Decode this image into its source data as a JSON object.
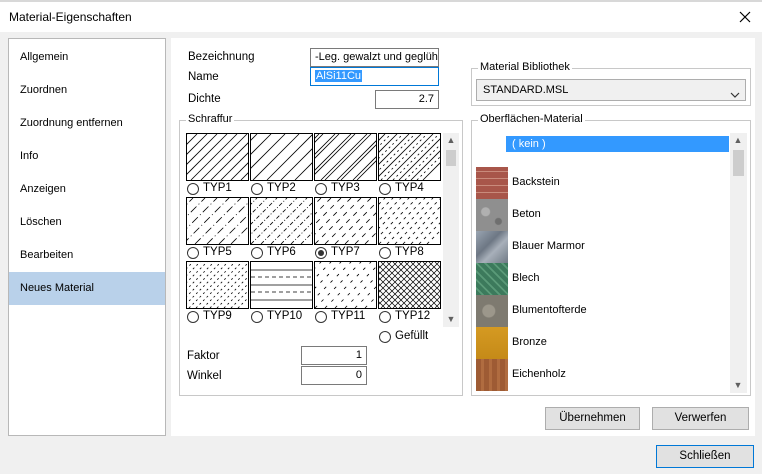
{
  "window": {
    "title": "Material-Eigenschaften"
  },
  "sidebar": {
    "items": [
      {
        "label": "Allgemein"
      },
      {
        "label": "Zuordnen"
      },
      {
        "label": "Zuordnung entfernen"
      },
      {
        "label": "Info"
      },
      {
        "label": "Anzeigen"
      },
      {
        "label": "Löschen"
      },
      {
        "label": "Bearbeiten"
      },
      {
        "label": "Neues Material",
        "active": true
      }
    ]
  },
  "fields": {
    "bezeichnung_label": "Bezeichnung",
    "bezeichnung_value": "-Leg. gewalzt und geglüht",
    "name_label": "Name",
    "name_value": "AlSi11Cu",
    "dichte_label": "Dichte",
    "dichte_value": "2.7"
  },
  "schraffur": {
    "title": "Schraffur",
    "types": [
      "TYP1",
      "TYP2",
      "TYP3",
      "TYP4",
      "TYP5",
      "TYP6",
      "TYP7",
      "TYP8",
      "TYP9",
      "TYP10",
      "TYP11",
      "TYP12"
    ],
    "selected": "TYP7",
    "gefuellt_label": "Gefüllt",
    "faktor_label": "Faktor",
    "faktor_value": "1",
    "winkel_label": "Winkel",
    "winkel_value": "0"
  },
  "bibliothek": {
    "title": "Material Bibliothek",
    "selected": "STANDARD.MSL"
  },
  "oberflaechen": {
    "title": "Oberflächen-Material",
    "none_label": "( kein )",
    "items": [
      {
        "name": "Backstein",
        "color": "#a8564a"
      },
      {
        "name": "Beton",
        "color": "#8f8f8f"
      },
      {
        "name": "Blauer Marmor",
        "color": "#7d8896"
      },
      {
        "name": "Blech",
        "color": "#3c7a5c"
      },
      {
        "name": "Blumentofterde",
        "color": "#7e7a70"
      },
      {
        "name": "Bronze",
        "color": "#d59a22"
      },
      {
        "name": "Eichenholz",
        "color": "#9e5b34"
      }
    ]
  },
  "buttons": {
    "uebernehmen": "Übernehmen",
    "verwerfen": "Verwerfen",
    "schliessen": "Schließen"
  }
}
